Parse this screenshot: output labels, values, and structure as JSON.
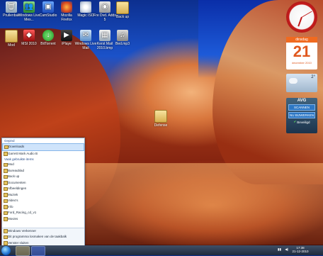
{
  "desktop_icons": [
    {
      "label": "Prullenbak",
      "icon": "recycle-bin-icon"
    },
    {
      "label": "Windows Live Mes...",
      "icon": "messenger-icon"
    },
    {
      "label": "CamStudio",
      "icon": "camstudio-icon"
    },
    {
      "label": "Mozilla Firefox",
      "icon": "firefox-icon"
    },
    {
      "label": "Magic ISO",
      "icon": "disc-icon"
    },
    {
      "label": "Fre Dvd. Adds 5",
      "icon": "dvd-icon"
    },
    {
      "label": "Back up",
      "icon": "folder-icon"
    },
    {
      "label": "Mod",
      "icon": "folder-icon"
    },
    {
      "label": "MSI 2010",
      "icon": "msi-icon"
    },
    {
      "label": "BitTorrent",
      "icon": "bittorrent-icon"
    },
    {
      "label": "iPlaye",
      "icon": "app-icon"
    },
    {
      "label": "Windows Live Mail",
      "icon": "mail-icon"
    },
    {
      "label": "Kerst Mail 2010.bmp",
      "icon": "image-icon"
    },
    {
      "label": "Bed.mp3",
      "icon": "audio-icon"
    },
    {
      "label": "Defense",
      "icon": "folder-icon"
    }
  ],
  "gadgets": {
    "calendar": {
      "weekday": "dinsdag",
      "day": "21",
      "month": "december 2010"
    },
    "weather": {
      "temp": "2°"
    },
    "avg": {
      "title": "AVG",
      "scan": "SCANNEN",
      "update": "NU BIJWERKEN",
      "status": "Beveiligd"
    }
  },
  "start_menu": {
    "pinned_header": "Gepind",
    "pinned": [
      "Downloads",
      "Garrett Mark Audio B"
    ],
    "recent_header": "Vaak gebruikte items",
    "recent": [
      "Mod",
      "Bureaublad",
      "Back up",
      "Documenten",
      "Afbeeldingen",
      "Muziek",
      "Video's",
      "Info",
      "Ford_Racing_cd_v1",
      "Movies"
    ],
    "footer": [
      "Windows Verkenner",
      "Dit programma losmaken van de taakbalk",
      "Venster sluiten"
    ]
  },
  "taskbar": {
    "time": "17:38",
    "date": "21-12-2010"
  }
}
